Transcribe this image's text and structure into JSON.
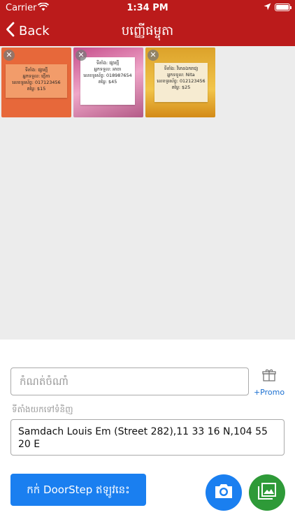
{
  "status_bar": {
    "carrier": "Carrier",
    "time": "1:34 PM"
  },
  "nav": {
    "back_label": "Back",
    "title": "បញ្ញើផម្ចុតា"
  },
  "photos": [
    {
      "lines": [
        "ទីតាំង: ផ្សារថ្មី",
        "អ្នកទទួល: ថ្ញើកា",
        "លេខទូរស័ព្ទ: 017123456",
        "តម្លៃ: $15"
      ]
    },
    {
      "lines": [
        "ទីតាំង: ផ្សារថ្មី",
        "អ្នកទទួល: អាចា",
        "លេខទូរស័ព្ទ: 018987654",
        "តម្លៃ: $45"
      ]
    },
    {
      "lines": [
        "ទីតាំង: វិមានឯករាជ្យ",
        "អ្នកទទួល: Nita",
        "លេខទូរស័ព្ទ: 012123456",
        "តម្លៃ: $25"
      ]
    }
  ],
  "form": {
    "remark_placeholder": "កំណត់ចំណាំ",
    "promo_label": "+Promo",
    "address_label": "ទីតាំងយកទៅទំនិញ",
    "address_value": "Samdach Louis Em (Street 282),11 33 16 N,104 55 20 E"
  },
  "actions": {
    "doorstep_label": "កក់ DoorStep ឥឡូវនេះ"
  },
  "colors": {
    "header": "#bb1b1b",
    "primary": "#1a7ff0",
    "gallery": "#2e9a38",
    "promo_text": "#1a6fd1"
  },
  "icons": {
    "back": "chevron-left-icon",
    "promo": "gift-icon",
    "camera": "camera-icon",
    "gallery": "image-icon",
    "remove": "close-icon"
  }
}
